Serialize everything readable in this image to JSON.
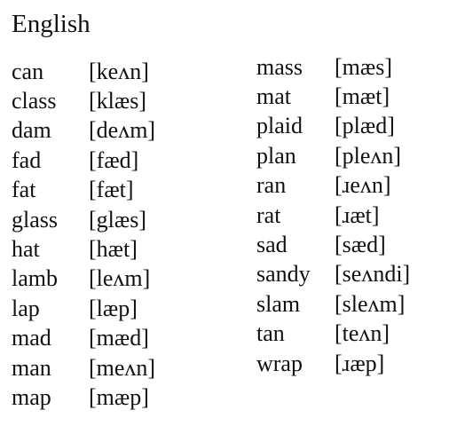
{
  "heading": "English",
  "left_column": [
    {
      "word": "can",
      "ipa": "[keʌn]"
    },
    {
      "word": "class",
      "ipa": "[klæs]"
    },
    {
      "word": "dam",
      "ipa": "[deʌm]"
    },
    {
      "word": "fad",
      "ipa": "[fæd]"
    },
    {
      "word": "fat",
      "ipa": "[fæt]"
    },
    {
      "word": "glass",
      "ipa": "[glæs]"
    },
    {
      "word": "hat",
      "ipa": "[hæt]"
    },
    {
      "word": "lamb",
      "ipa": "[leʌm]"
    },
    {
      "word": "lap",
      "ipa": "[læp]"
    },
    {
      "word": "mad",
      "ipa": "[mæd]"
    },
    {
      "word": "man",
      "ipa": "[meʌn]"
    },
    {
      "word": "map",
      "ipa": "[mæp]"
    }
  ],
  "right_column": [
    {
      "word": "mass",
      "ipa": "[mæs]"
    },
    {
      "word": "mat",
      "ipa": "[mæt]"
    },
    {
      "word": "plaid",
      "ipa": "[plæd]"
    },
    {
      "word": "plan",
      "ipa": "[pleʌn]"
    },
    {
      "word": "ran",
      "ipa": "[ɹeʌn]"
    },
    {
      "word": "rat",
      "ipa": "[ɹæt]"
    },
    {
      "word": "sad",
      "ipa": "[sæd]"
    },
    {
      "word": "sandy",
      "ipa": "[seʌndi]"
    },
    {
      "word": "slam",
      "ipa": "[sleʌm]"
    },
    {
      "word": "tan",
      "ipa": "[teʌn]"
    },
    {
      "word": "wrap",
      "ipa": "[ɹæp]"
    }
  ]
}
